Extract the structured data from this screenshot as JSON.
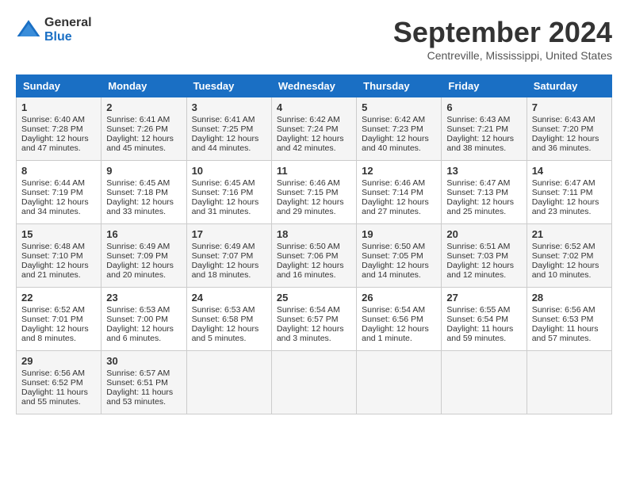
{
  "header": {
    "logo_general": "General",
    "logo_blue": "Blue",
    "title": "September 2024",
    "location": "Centreville, Mississippi, United States"
  },
  "days_of_week": [
    "Sunday",
    "Monday",
    "Tuesday",
    "Wednesday",
    "Thursday",
    "Friday",
    "Saturday"
  ],
  "weeks": [
    [
      {
        "day": "1",
        "lines": [
          "Sunrise: 6:40 AM",
          "Sunset: 7:28 PM",
          "Daylight: 12 hours",
          "and 47 minutes."
        ]
      },
      {
        "day": "2",
        "lines": [
          "Sunrise: 6:41 AM",
          "Sunset: 7:26 PM",
          "Daylight: 12 hours",
          "and 45 minutes."
        ]
      },
      {
        "day": "3",
        "lines": [
          "Sunrise: 6:41 AM",
          "Sunset: 7:25 PM",
          "Daylight: 12 hours",
          "and 44 minutes."
        ]
      },
      {
        "day": "4",
        "lines": [
          "Sunrise: 6:42 AM",
          "Sunset: 7:24 PM",
          "Daylight: 12 hours",
          "and 42 minutes."
        ]
      },
      {
        "day": "5",
        "lines": [
          "Sunrise: 6:42 AM",
          "Sunset: 7:23 PM",
          "Daylight: 12 hours",
          "and 40 minutes."
        ]
      },
      {
        "day": "6",
        "lines": [
          "Sunrise: 6:43 AM",
          "Sunset: 7:21 PM",
          "Daylight: 12 hours",
          "and 38 minutes."
        ]
      },
      {
        "day": "7",
        "lines": [
          "Sunrise: 6:43 AM",
          "Sunset: 7:20 PM",
          "Daylight: 12 hours",
          "and 36 minutes."
        ]
      }
    ],
    [
      {
        "day": "8",
        "lines": [
          "Sunrise: 6:44 AM",
          "Sunset: 7:19 PM",
          "Daylight: 12 hours",
          "and 34 minutes."
        ]
      },
      {
        "day": "9",
        "lines": [
          "Sunrise: 6:45 AM",
          "Sunset: 7:18 PM",
          "Daylight: 12 hours",
          "and 33 minutes."
        ]
      },
      {
        "day": "10",
        "lines": [
          "Sunrise: 6:45 AM",
          "Sunset: 7:16 PM",
          "Daylight: 12 hours",
          "and 31 minutes."
        ]
      },
      {
        "day": "11",
        "lines": [
          "Sunrise: 6:46 AM",
          "Sunset: 7:15 PM",
          "Daylight: 12 hours",
          "and 29 minutes."
        ]
      },
      {
        "day": "12",
        "lines": [
          "Sunrise: 6:46 AM",
          "Sunset: 7:14 PM",
          "Daylight: 12 hours",
          "and 27 minutes."
        ]
      },
      {
        "day": "13",
        "lines": [
          "Sunrise: 6:47 AM",
          "Sunset: 7:13 PM",
          "Daylight: 12 hours",
          "and 25 minutes."
        ]
      },
      {
        "day": "14",
        "lines": [
          "Sunrise: 6:47 AM",
          "Sunset: 7:11 PM",
          "Daylight: 12 hours",
          "and 23 minutes."
        ]
      }
    ],
    [
      {
        "day": "15",
        "lines": [
          "Sunrise: 6:48 AM",
          "Sunset: 7:10 PM",
          "Daylight: 12 hours",
          "and 21 minutes."
        ]
      },
      {
        "day": "16",
        "lines": [
          "Sunrise: 6:49 AM",
          "Sunset: 7:09 PM",
          "Daylight: 12 hours",
          "and 20 minutes."
        ]
      },
      {
        "day": "17",
        "lines": [
          "Sunrise: 6:49 AM",
          "Sunset: 7:07 PM",
          "Daylight: 12 hours",
          "and 18 minutes."
        ]
      },
      {
        "day": "18",
        "lines": [
          "Sunrise: 6:50 AM",
          "Sunset: 7:06 PM",
          "Daylight: 12 hours",
          "and 16 minutes."
        ]
      },
      {
        "day": "19",
        "lines": [
          "Sunrise: 6:50 AM",
          "Sunset: 7:05 PM",
          "Daylight: 12 hours",
          "and 14 minutes."
        ]
      },
      {
        "day": "20",
        "lines": [
          "Sunrise: 6:51 AM",
          "Sunset: 7:03 PM",
          "Daylight: 12 hours",
          "and 12 minutes."
        ]
      },
      {
        "day": "21",
        "lines": [
          "Sunrise: 6:52 AM",
          "Sunset: 7:02 PM",
          "Daylight: 12 hours",
          "and 10 minutes."
        ]
      }
    ],
    [
      {
        "day": "22",
        "lines": [
          "Sunrise: 6:52 AM",
          "Sunset: 7:01 PM",
          "Daylight: 12 hours",
          "and 8 minutes."
        ]
      },
      {
        "day": "23",
        "lines": [
          "Sunrise: 6:53 AM",
          "Sunset: 7:00 PM",
          "Daylight: 12 hours",
          "and 6 minutes."
        ]
      },
      {
        "day": "24",
        "lines": [
          "Sunrise: 6:53 AM",
          "Sunset: 6:58 PM",
          "Daylight: 12 hours",
          "and 5 minutes."
        ]
      },
      {
        "day": "25",
        "lines": [
          "Sunrise: 6:54 AM",
          "Sunset: 6:57 PM",
          "Daylight: 12 hours",
          "and 3 minutes."
        ]
      },
      {
        "day": "26",
        "lines": [
          "Sunrise: 6:54 AM",
          "Sunset: 6:56 PM",
          "Daylight: 12 hours",
          "and 1 minute."
        ]
      },
      {
        "day": "27",
        "lines": [
          "Sunrise: 6:55 AM",
          "Sunset: 6:54 PM",
          "Daylight: 11 hours",
          "and 59 minutes."
        ]
      },
      {
        "day": "28",
        "lines": [
          "Sunrise: 6:56 AM",
          "Sunset: 6:53 PM",
          "Daylight: 11 hours",
          "and 57 minutes."
        ]
      }
    ],
    [
      {
        "day": "29",
        "lines": [
          "Sunrise: 6:56 AM",
          "Sunset: 6:52 PM",
          "Daylight: 11 hours",
          "and 55 minutes."
        ]
      },
      {
        "day": "30",
        "lines": [
          "Sunrise: 6:57 AM",
          "Sunset: 6:51 PM",
          "Daylight: 11 hours",
          "and 53 minutes."
        ]
      },
      {
        "day": "",
        "lines": []
      },
      {
        "day": "",
        "lines": []
      },
      {
        "day": "",
        "lines": []
      },
      {
        "day": "",
        "lines": []
      },
      {
        "day": "",
        "lines": []
      }
    ]
  ]
}
